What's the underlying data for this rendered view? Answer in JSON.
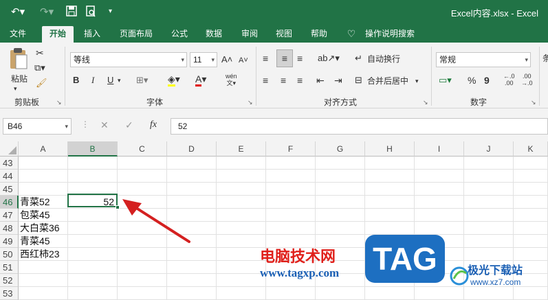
{
  "window": {
    "title": "Excel内容.xlsx - Excel"
  },
  "tabs": [
    "文件",
    "开始",
    "插入",
    "页面布局",
    "公式",
    "数据",
    "审阅",
    "视图",
    "帮助",
    "操作说明搜索"
  ],
  "active_tab": "开始",
  "ribbon": {
    "clipboard": {
      "paste": "粘贴",
      "label": "剪贴板"
    },
    "font": {
      "name": "等线",
      "size": "11",
      "bold": "B",
      "italic": "I",
      "underline": "U",
      "label": "字体",
      "grow": "A",
      "shrink": "A",
      "phonetic": "wén"
    },
    "alignment": {
      "wrap": "自动换行",
      "merge": "合并后居中",
      "label": "对齐方式"
    },
    "number": {
      "format": "常规",
      "percent": "%",
      "comma": "9",
      "label": "数字"
    },
    "cut_off": "条"
  },
  "formula_bar": {
    "name_box": "B46",
    "fx": "fx",
    "content": "52"
  },
  "columns": [
    "A",
    "B",
    "C",
    "D",
    "E",
    "F",
    "G",
    "H",
    "I",
    "J",
    "K"
  ],
  "rows": [
    {
      "num": "43",
      "a": "",
      "b": ""
    },
    {
      "num": "44",
      "a": "",
      "b": ""
    },
    {
      "num": "45",
      "a": "",
      "b": ""
    },
    {
      "num": "46",
      "a": "青菜52",
      "b": "52"
    },
    {
      "num": "47",
      "a": "包菜45",
      "b": ""
    },
    {
      "num": "48",
      "a": "大白菜36",
      "b": ""
    },
    {
      "num": "49",
      "a": "青菜45",
      "b": ""
    },
    {
      "num": "50",
      "a": "西红柿23",
      "b": ""
    },
    {
      "num": "51",
      "a": "",
      "b": ""
    },
    {
      "num": "52",
      "a": "",
      "b": ""
    },
    {
      "num": "53",
      "a": "",
      "b": ""
    }
  ],
  "watermark": {
    "cn": "电脑技术网",
    "url": "www.tagxp.com",
    "tag": "TAG",
    "xz_name": "极光下载站",
    "xz_url": "www.xz7.com"
  },
  "colors": {
    "brand": "#217346",
    "arrow": "#d42020"
  }
}
